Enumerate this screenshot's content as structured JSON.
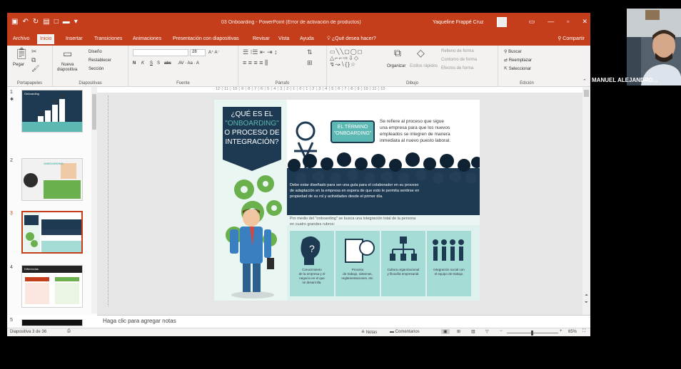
{
  "window": {
    "title": "03 Onboarding - PowerPoint (Error de activación de productos)",
    "user": "Yaqueline Frappé Cruz",
    "controls": {
      "minimize": "—",
      "restore": "▫",
      "close": "✕"
    }
  },
  "qat": {
    "save_icon": "save-icon",
    "undo_icon": "undo-icon",
    "redo_icon": "redo-icon"
  },
  "tabs": [
    "Archivo",
    "Inicio",
    "Insertar",
    "Transiciones",
    "Animaciones",
    "Presentación con diapositivas",
    "Revisar",
    "Vista",
    "Ayuda",
    "¿Qué desea hacer?"
  ],
  "share_label": "Compartir",
  "ribbon": {
    "portapapeles": {
      "label": "Portapapeles",
      "pegar": "Pegar"
    },
    "diapositivas": {
      "label": "Diapositivas",
      "nueva": "Nueva",
      "diapositiva": "diapositiva",
      "diseno": "Diseño",
      "restablecer": "Restablecer",
      "seccion": "Sección"
    },
    "fuente": {
      "label": "Fuente",
      "size": "28",
      "bold": "N",
      "italic": "K",
      "underline": "S",
      "strike": "S",
      "spacing": "abc"
    },
    "parrafo": {
      "label": "Párrafo"
    },
    "dibujo": {
      "label": "Dibujo",
      "organizar": "Organizar",
      "estilos": "Estilos rápidos",
      "relleno": "Relleno de forma",
      "contorno": "Contorno de forma",
      "efectos": "Efectos de forma"
    },
    "edicion": {
      "label": "Edición",
      "buscar": "Buscar",
      "reemplazar": "Reemplazar",
      "seleccionar": "Seleccionar"
    }
  },
  "ruler": "·12·¦·11·¦·10·¦·9·¦·8·¦·7·¦·6·¦·5·¦·4·¦·3·¦·2·¦·1·¦·0·¦·1·¦·2·¦·3·¦·4·¦·5·¦·6·¦·7·¦·8·¦·9·¦·10·¦·11·¦·12·",
  "thumbnails": [
    {
      "num": "1",
      "title": "Onboarding"
    },
    {
      "num": "2",
      "title": "ONBOARDING"
    },
    {
      "num": "3",
      "title": ""
    },
    {
      "num": "4",
      "title": "Diferencias"
    },
    {
      "num": "5",
      "title": ""
    }
  ],
  "slide": {
    "question": [
      "¿QUÉ ES EL",
      "\"ONBOARDING\"",
      "O PROCESO DE",
      "INTEGRACIÓN?"
    ],
    "term_label": [
      "EL TÉRMINO",
      "\"ONBOARDING\""
    ],
    "definition": [
      "Se refiere al proceso que sigue",
      "una empresa para que los nuevos",
      "empleados se integren de manera",
      "inmediata al nuevo puesto laboral."
    ],
    "guide_text": [
      "Debe estar diseñado para ser una guía para el colaborador en su proceso",
      "de adaptación en la empresa en espera de que esto le permita sentirse en",
      "propiedad de su rol y actividades desde el primer día."
    ],
    "rubros_intro": [
      "Por medio del \"onboarding\" se busca una integración total de la persona",
      "en cuatro grandes rubros:"
    ],
    "rubros": [
      {
        "icon": "question-head-icon",
        "text": [
          "Conocimiento",
          "de la empresa y el",
          "negocio en el que",
          "se desarrolla."
        ]
      },
      {
        "icon": "document-clock-icon",
        "text": [
          "Proceso",
          "de trabajo, sistemas,",
          "reglamentaciones, etc."
        ]
      },
      {
        "icon": "org-chart-icon",
        "text": [
          "Cultura organizacional",
          "y filosofía empresarial."
        ]
      },
      {
        "icon": "team-icon",
        "text": [
          "Integración social con",
          "el equipo de trabajo."
        ]
      }
    ]
  },
  "notes_placeholder": "Haga clic para agregar notas",
  "status": {
    "slide_count": "Diapositiva 3 de 36",
    "notas": "Notas",
    "comentarios": "Comentarios",
    "zoom": "65%"
  },
  "camera": {
    "name": "MANUEL ALEJANDRO..."
  },
  "colors": {
    "accent": "#c43e1c",
    "navy": "#1e3a52",
    "teal": "#5cb8b2",
    "green": "#6ab04c"
  }
}
